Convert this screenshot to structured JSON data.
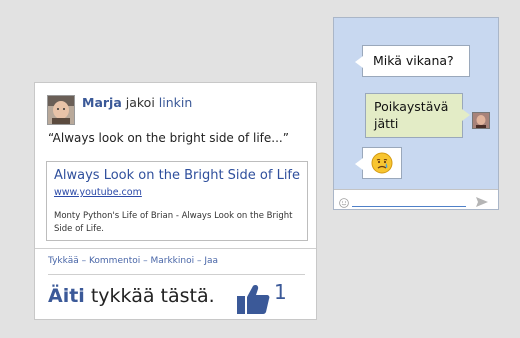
{
  "post": {
    "author": "Marja",
    "action_text": " jakoi ",
    "link_word": "linkin",
    "quote": "“Always look on the bright side of life...”",
    "preview": {
      "title": "Always Look on the Bright Side of Life",
      "url": "www.youtube.com",
      "description": "Monty Python's Life of Brian - Always Look on the Bright Side of Life."
    },
    "actions": {
      "like": "Tykkää",
      "comment": "Kommentoi",
      "market": "Markkinoi",
      "share": "Jaa",
      "separator": " – "
    },
    "likes": {
      "liker": "Äiti",
      "text": " tykkää tästä.",
      "count": "1",
      "thumb_icon": "thumbs-up-icon"
    }
  },
  "chat": {
    "messages": [
      {
        "text": "Mikä vikana?",
        "side": "left"
      },
      {
        "text": "Poikaystävä jätti",
        "side": "right"
      },
      {
        "text": "😢",
        "side": "left"
      }
    ],
    "input_placeholder": "",
    "emoji_icon": "smiley-icon",
    "send_icon": "send-icon"
  },
  "colors": {
    "fb_blue": "#3b5998",
    "chat_bg": "#c8d8f0",
    "sent_bubble": "#e3ecc6"
  }
}
